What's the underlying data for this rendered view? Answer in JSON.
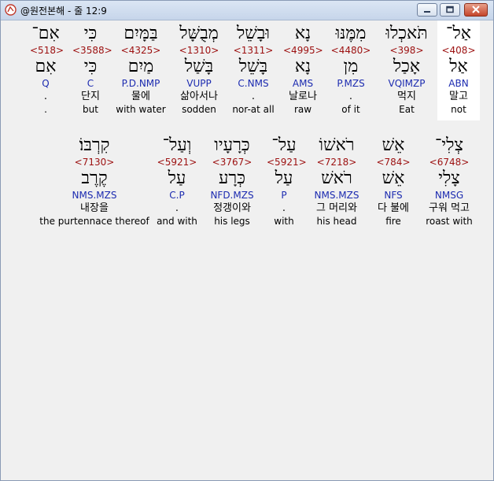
{
  "window": {
    "title": "@원전본해 - 줄 12:9"
  },
  "rows": [
    [
      {
        "heb": "אַל־",
        "num": "<408>",
        "lemma": "אַל",
        "parse": "ABN",
        "kor": "말고",
        "eng": "not",
        "selected": true
      },
      {
        "heb": "תֹּאכְלוּ",
        "num": "<398>",
        "lemma": "אָכַל",
        "parse": "VQIMZP",
        "kor": "먹지",
        "eng": "Eat",
        "selected": false
      },
      {
        "heb": "מִמֶּנּוּ",
        "num": "<4480>",
        "lemma": "מִן",
        "parse": "P.MZS",
        "kor": ".",
        "eng": "of it",
        "selected": false
      },
      {
        "heb": "נָא",
        "num": "<4995>",
        "lemma": "נָא",
        "parse": "AMS",
        "kor": "날로나",
        "eng": "raw",
        "selected": false
      },
      {
        "heb": "וּבָשֵׁל",
        "num": "<1311>",
        "lemma": "בָּשֵׁל",
        "parse": "C.NMS",
        "kor": ".",
        "eng": "nor-at all",
        "selected": false
      },
      {
        "heb": "מְבֻשָּׁל",
        "num": "<1310>",
        "lemma": "בָּשַׁל",
        "parse": "VUPP",
        "kor": "삶아서나",
        "eng": "sodden",
        "selected": false
      },
      {
        "heb": "בַּמָּיִם",
        "num": "<4325>",
        "lemma": "מַיִם",
        "parse": "P.D.NMP",
        "kor": "물에",
        "eng": "with water",
        "selected": false
      },
      {
        "heb": "כִּי",
        "num": "<3588>",
        "lemma": "כִּי",
        "parse": "C",
        "kor": "단지",
        "eng": "but",
        "selected": false
      },
      {
        "heb": "אִם־",
        "num": "<518>",
        "lemma": "אִם",
        "parse": "Q",
        "kor": ".",
        "eng": ".",
        "selected": false
      }
    ],
    [
      {
        "heb": "צְלִי־",
        "num": "<6748>",
        "lemma": "צָלִי",
        "parse": "NMSG",
        "kor": "구워 먹고",
        "eng": "roast with",
        "selected": false
      },
      {
        "heb": "אֵשׁ",
        "num": "<784>",
        "lemma": "אֵשׁ",
        "parse": "NFS",
        "kor": "다 불에",
        "eng": "fire",
        "selected": false
      },
      {
        "heb": "רֹאשׁוֹ",
        "num": "<7218>",
        "lemma": "רֹאשׁ",
        "parse": "NMS.MZS",
        "kor": "그 머리와",
        "eng": "his head",
        "selected": false
      },
      {
        "heb": "עַל־",
        "num": "<5921>",
        "lemma": "עַל",
        "parse": "P",
        "kor": ".",
        "eng": "with",
        "selected": false
      },
      {
        "heb": "כְּרָעָיו",
        "num": "<3767>",
        "lemma": "כְּרָע",
        "parse": "NFD.MZS",
        "kor": "정갱이와",
        "eng": "his legs",
        "selected": false
      },
      {
        "heb": "וְעַל־",
        "num": "<5921>",
        "lemma": "עַל",
        "parse": "C.P",
        "kor": ".",
        "eng": "and with",
        "selected": false
      },
      {
        "heb": "קִרְבּוֹ׃",
        "num": "<7130>",
        "lemma": "קֶרֶב",
        "parse": "NMS.MZS",
        "kor": "내장을",
        "eng": "the purtennace thereof",
        "selected": false
      }
    ]
  ]
}
